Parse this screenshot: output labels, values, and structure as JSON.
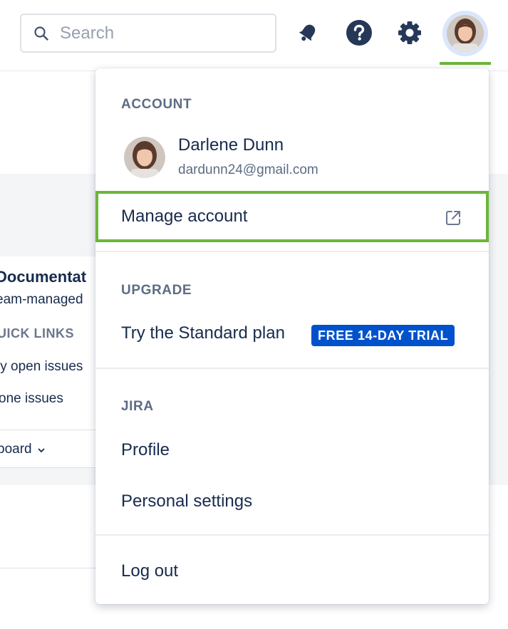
{
  "search": {
    "placeholder": "Search"
  },
  "header": {
    "icons": [
      "search-icon",
      "notifications-icon",
      "help-icon",
      "settings-icon",
      "avatar"
    ]
  },
  "background": {
    "project_title": "Documentat",
    "project_type": "eam-managed",
    "quick_links_heading": "UICK LINKS",
    "link_1": "ly open issues",
    "link_2": "one issues",
    "board_label": "board"
  },
  "menu": {
    "account": {
      "heading": "ACCOUNT",
      "user_name": "Darlene Dunn",
      "user_email": "dardunn24@gmail.com",
      "manage_label": "Manage account"
    },
    "upgrade": {
      "heading": "UPGRADE",
      "item_label": "Try the Standard plan",
      "badge": "FREE 14-DAY TRIAL"
    },
    "jira": {
      "heading": "JIRA",
      "items": [
        "Profile",
        "Personal settings"
      ]
    },
    "logout_label": "Log out"
  },
  "colors": {
    "highlight": "#6cb53a",
    "badge_bg": "#0052cc",
    "text": "#172b4d",
    "subtle_text": "#5e6c84"
  }
}
